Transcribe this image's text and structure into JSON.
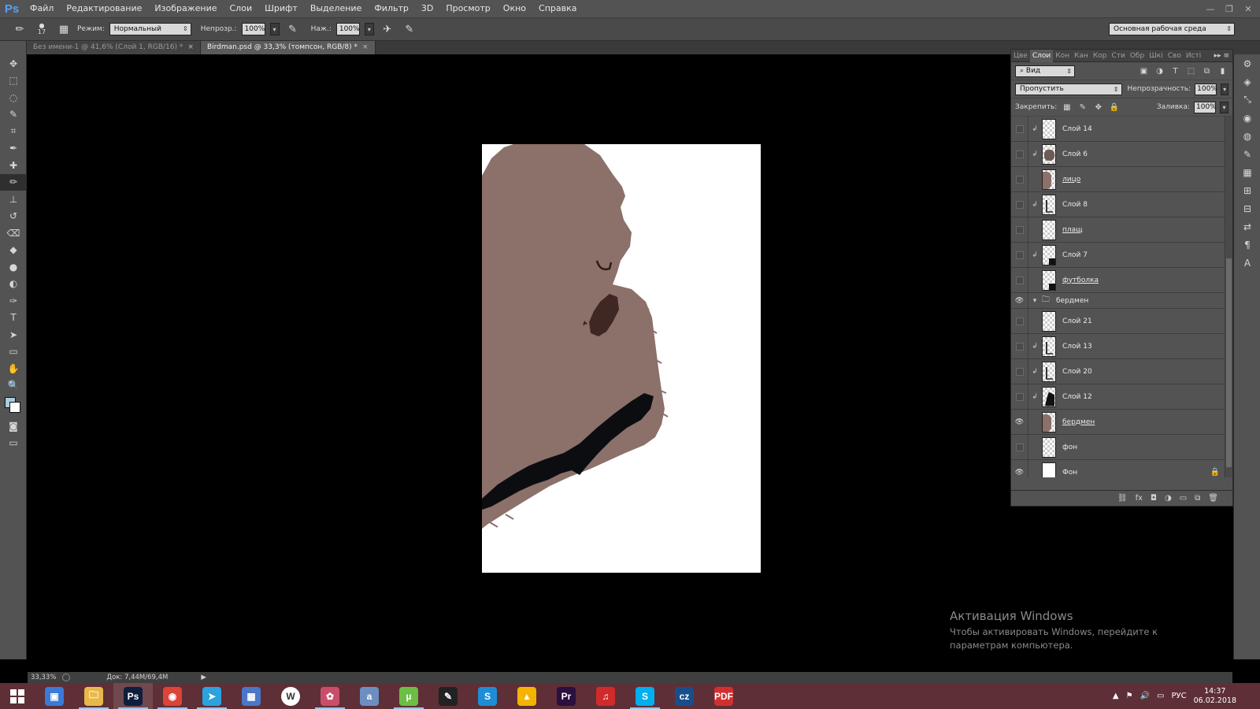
{
  "app": {
    "logo": "Ps",
    "menu": [
      "Файл",
      "Редактирование",
      "Изображение",
      "Слои",
      "Шрифт",
      "Выделение",
      "Фильтр",
      "3D",
      "Просмотр",
      "Окно",
      "Справка"
    ],
    "window_controls": [
      "—",
      "❐",
      "✕"
    ]
  },
  "options": {
    "brush_size": "17",
    "mode_label": "Режим:",
    "mode_value": "Нормальный",
    "opacity_label": "Непрозр.:",
    "opacity_value": "100%",
    "flow_label": "Наж.:",
    "flow_value": "100%",
    "workspace": "Основная рабочая среда"
  },
  "tabs": [
    {
      "label": "Без имени-1 @ 41,6% (Слой 1, RGB/16) *",
      "active": false
    },
    {
      "label": "Birdman.psd @ 33,3% (томпсон, RGB/8) *",
      "active": true
    }
  ],
  "toolbar": {
    "tools": [
      "move-tool",
      "marquee-tool",
      "lasso-tool",
      "quick-select-tool",
      "crop-tool",
      "eyedropper-tool",
      "healing-tool",
      "brush-tool",
      "stamp-tool",
      "history-brush-tool",
      "eraser-tool",
      "fill-tool",
      "blur-tool",
      "dodge-tool",
      "pen-tool",
      "type-tool",
      "path-select-tool",
      "shape-tool",
      "hand-tool",
      "zoom-tool"
    ],
    "glyphs": [
      "✥",
      "⬚",
      "◌",
      "✎",
      "⌗",
      "✒",
      "✚",
      "✏",
      "⊥",
      "↺",
      "⌫",
      "◆",
      "●",
      "◐",
      "✑",
      "T",
      "➤",
      "▭",
      "✋",
      "🔍"
    ],
    "active_index": 7,
    "foreground_color": "#a9cde0",
    "background_color": "#ffffff"
  },
  "layers_panel": {
    "tabs": [
      "Цве",
      "Слои",
      "Кон",
      "Кан",
      "Кор",
      "Сти",
      "Обр",
      "Шкі",
      "Сво",
      "Исті"
    ],
    "active_tab": 1,
    "menu_glyph": "▸▸ ≡",
    "filter_value": "Вид",
    "blend_mode": "Пропустить",
    "opacity_label": "Непрозрачность:",
    "opacity_value": "100%",
    "lock_label": "Закрепить:",
    "fill_label": "Заливка:",
    "fill_value": "100%",
    "layers": [
      {
        "name": "Слой 14",
        "visible": false,
        "clipped": true,
        "linked": false,
        "thumb": "plain"
      },
      {
        "name": "Слой 6",
        "visible": false,
        "clipped": true,
        "linked": false,
        "thumb": "face"
      },
      {
        "name": "лицо",
        "visible": false,
        "clipped": false,
        "linked": true,
        "thumb": "skin"
      },
      {
        "name": "Слой 8",
        "visible": false,
        "clipped": true,
        "linked": false,
        "thumb": "sketch"
      },
      {
        "name": "плащ",
        "visible": false,
        "clipped": false,
        "linked": true,
        "thumb": "plain"
      },
      {
        "name": "Слой 7",
        "visible": false,
        "clipped": true,
        "linked": false,
        "thumb": "dark"
      },
      {
        "name": "футболка",
        "visible": false,
        "clipped": false,
        "linked": true,
        "thumb": "dark"
      },
      {
        "name": "бердмен",
        "visible": true,
        "clipped": false,
        "linked": false,
        "thumb": "group"
      },
      {
        "name": "Слой 21",
        "visible": false,
        "clipped": false,
        "linked": false,
        "thumb": "plain"
      },
      {
        "name": "Слой 13",
        "visible": false,
        "clipped": true,
        "linked": false,
        "thumb": "sketch"
      },
      {
        "name": "Слой 20",
        "visible": false,
        "clipped": true,
        "linked": false,
        "thumb": "sketch"
      },
      {
        "name": "Слой 12",
        "visible": false,
        "clipped": true,
        "linked": false,
        "thumb": "black"
      },
      {
        "name": "бердмен",
        "visible": true,
        "clipped": false,
        "linked": true,
        "thumb": "skin"
      },
      {
        "name": "фон",
        "visible": false,
        "clipped": false,
        "linked": false,
        "thumb": "plain"
      },
      {
        "name": "Фон",
        "visible": true,
        "clipped": false,
        "linked": false,
        "thumb": "white",
        "locked": true
      }
    ],
    "footer": [
      "⛓",
      "fx",
      "◘",
      "◑",
      "▭",
      "⧉",
      "🗑"
    ]
  },
  "right_strip": [
    "⚙",
    "◈",
    "⤡",
    "◉",
    "◍",
    "✎",
    "▦",
    "⊞",
    "⊟",
    "⇄",
    "¶",
    "A"
  ],
  "activation": {
    "title": "Активация Windows",
    "text": "Чтобы активировать Windows, перейдите к параметрам компьютера."
  },
  "status": {
    "zoom": "33,33%",
    "doc": "Док: 7,44M/69,4M",
    "arrow": "▶"
  },
  "taskbar": {
    "apps": [
      {
        "name": "explorer-view",
        "glyph": "▣",
        "color": "#3b7bd8",
        "open": false,
        "active": false
      },
      {
        "name": "file-explorer",
        "glyph": "🗀",
        "color": "#e8b84a",
        "open": true,
        "active": false
      },
      {
        "name": "photoshop",
        "glyph": "Ps",
        "color": "#0f1e3c",
        "open": true,
        "active": true
      },
      {
        "name": "chrome",
        "glyph": "◉",
        "color": "#db4437",
        "open": true,
        "active": false
      },
      {
        "name": "telegram",
        "glyph": "➤",
        "color": "#2aa3de",
        "open": true,
        "active": false
      },
      {
        "name": "calculator",
        "glyph": "▦",
        "color": "#4a77c8",
        "open": false,
        "active": false
      },
      {
        "name": "wps",
        "glyph": "W",
        "color": "#ffffff",
        "open": false,
        "active": false
      },
      {
        "name": "paint-app",
        "glyph": "✿",
        "color": "#c94e6a",
        "open": true,
        "active": false
      },
      {
        "name": "font-app",
        "glyph": "a",
        "color": "#6a8fc0",
        "open": false,
        "active": false
      },
      {
        "name": "utorrent",
        "glyph": "µ",
        "color": "#6cbe45",
        "open": true,
        "active": false
      },
      {
        "name": "pen-app",
        "glyph": "✎",
        "color": "#222222",
        "open": false,
        "active": false
      },
      {
        "name": "shazam",
        "glyph": "S",
        "color": "#1d8ed6",
        "open": false,
        "active": false
      },
      {
        "name": "aimp",
        "glyph": "▲",
        "color": "#f4b400",
        "open": false,
        "active": false
      },
      {
        "name": "premiere",
        "glyph": "Pr",
        "color": "#2a0f3f",
        "open": false,
        "active": false
      },
      {
        "name": "headphones-app",
        "glyph": "♫",
        "color": "#d02b2b",
        "open": false,
        "active": false
      },
      {
        "name": "skype",
        "glyph": "S",
        "color": "#00aff0",
        "open": true,
        "active": false
      },
      {
        "name": "cz-app",
        "glyph": "cz",
        "color": "#1a4e8a",
        "open": false,
        "active": false
      },
      {
        "name": "pdf-app",
        "glyph": "PDF",
        "color": "#d23030",
        "open": false,
        "active": false
      }
    ],
    "tray_glyphs": [
      "▲",
      "⚑",
      "🔊",
      "▭"
    ],
    "lang": "РУС",
    "time": "14:37",
    "date": "06.02.2018"
  }
}
